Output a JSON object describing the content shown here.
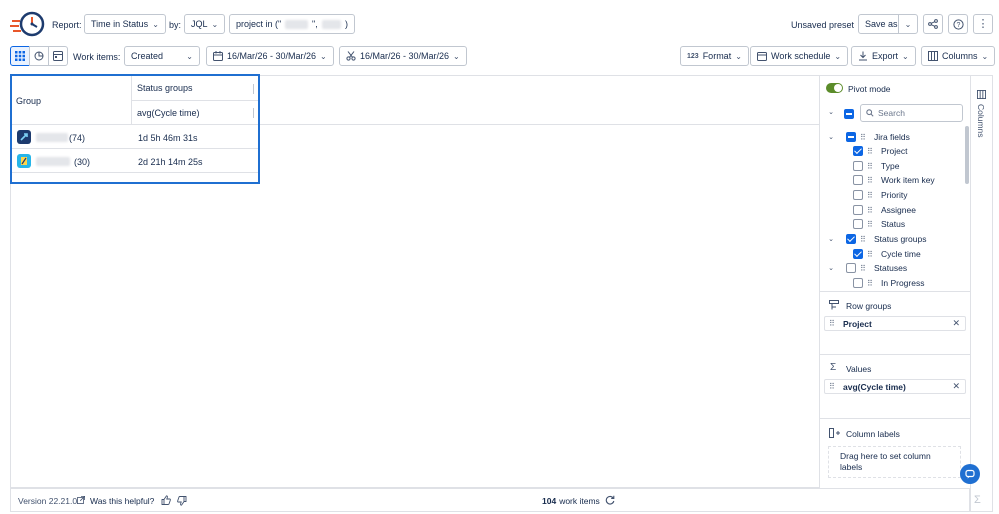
{
  "header": {
    "report_label": "Report:",
    "report_value": "Time in Status",
    "by_label": "by:",
    "by_value": "JQL",
    "jql_prefix": "project in (\"",
    "jql_sep": "\",",
    "jql_suffix": ")",
    "unsaved_preset": "Unsaved preset",
    "save_as": "Save as"
  },
  "toolbar": {
    "work_items_label": "Work items:",
    "work_items_value": "Created",
    "date_range_1": "16/Mar/26 - 30/Mar/26",
    "date_range_2": "16/Mar/26 - 30/Mar/26",
    "format": "Format",
    "format_prefix": "123",
    "work_schedule": "Work schedule",
    "export": "Export",
    "columns": "Columns"
  },
  "grid": {
    "group_header": "Group",
    "status_groups_header": "Status groups",
    "value_header": "avg(Cycle time)",
    "rows": [
      {
        "count": "(74)",
        "value": "1d 5h 46m 31s"
      },
      {
        "count": "(30)",
        "value": "2d 21h 14m 25s"
      }
    ]
  },
  "panel": {
    "pivot_mode": "Pivot mode",
    "search_placeholder": "Search",
    "side_tab": "Columns",
    "tree": {
      "jira_fields": "Jira fields",
      "project": "Project",
      "type": "Type",
      "work_item_key": "Work item key",
      "priority": "Priority",
      "assignee": "Assignee",
      "status": "Status",
      "status_groups": "Status groups",
      "cycle_time": "Cycle time",
      "statuses": "Statuses",
      "in_progress": "In Progress"
    },
    "row_groups_title": "Row groups",
    "row_group_chip": "Project",
    "values_title": "Values",
    "values_chip": "avg(Cycle time)",
    "column_labels_title": "Column labels",
    "drop_hint": "Drag here to set column labels"
  },
  "footer": {
    "version": "Version 22.21.0",
    "helpful": "Was this helpful?",
    "work_items_count": "104",
    "work_items_suffix": "work items"
  },
  "colors": {
    "accent": "#0c66e4",
    "highlight_border": "#1f6fd1",
    "toggle_on": "#5b8c2a"
  }
}
